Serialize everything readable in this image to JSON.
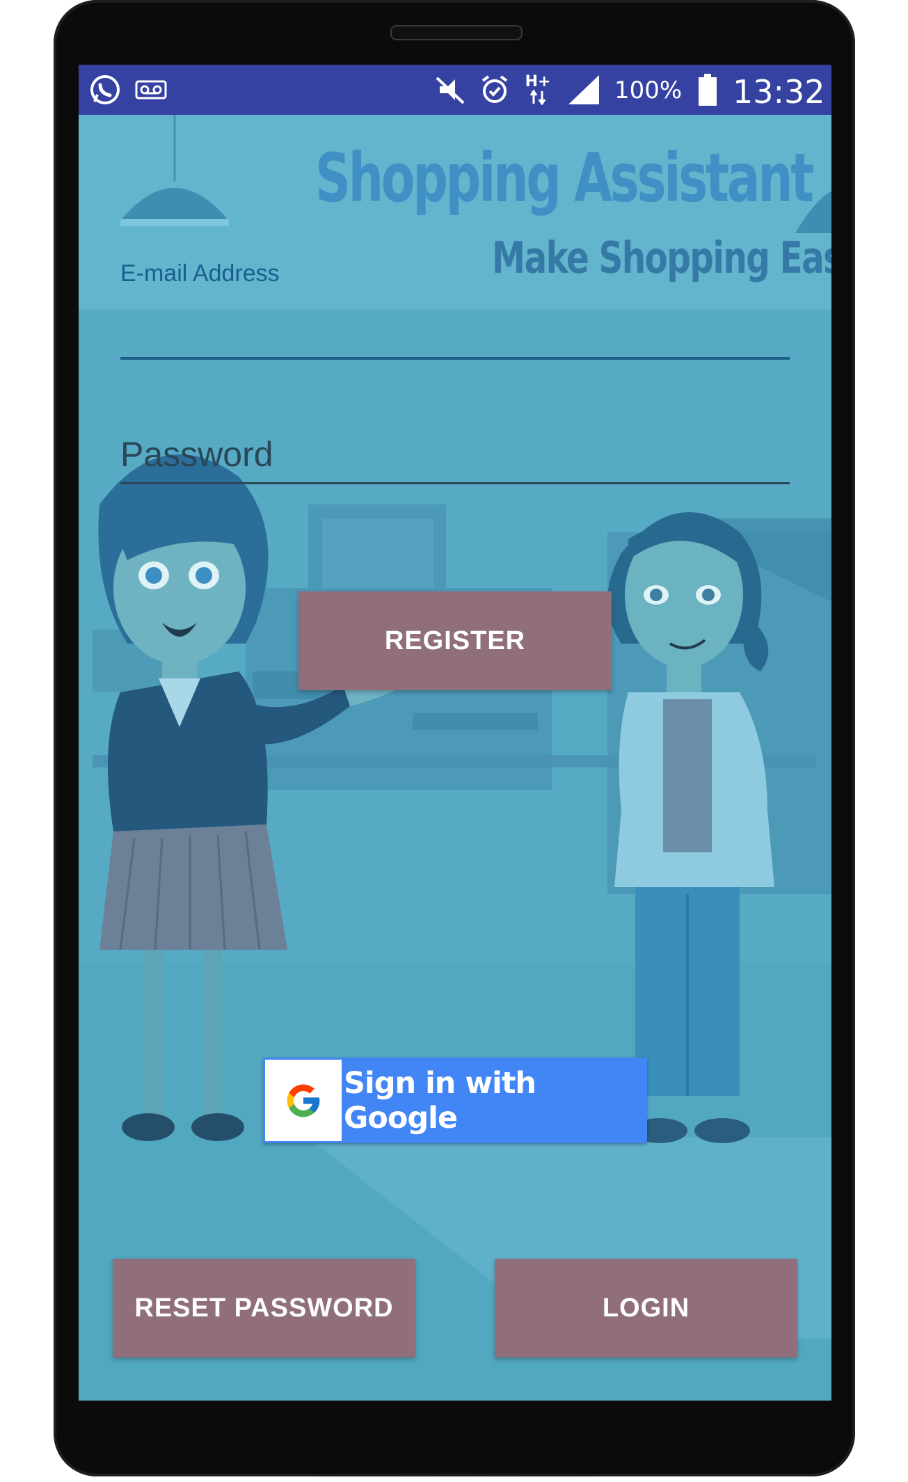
{
  "status_bar": {
    "battery": "100%",
    "time": "13:32",
    "network": "H+",
    "icons": [
      "whatsapp-icon",
      "voicemail-icon",
      "mute-vibrate-icon",
      "alarm-icon",
      "network-hplus-icon",
      "signal-icon",
      "battery-icon"
    ]
  },
  "app": {
    "title": "Shopping Assistant",
    "tagline": "Make Shopping Easy"
  },
  "form": {
    "email_label": "E-mail Address",
    "email_value": "",
    "password_placeholder": "Password",
    "password_value": ""
  },
  "buttons": {
    "register": "REGISTER",
    "google_sign_in": "Sign in with Google",
    "reset_password": "RESET PASSWORD",
    "login": "LOGIN"
  },
  "colors": {
    "status_bar": "#3542a2",
    "screen_background": "#5ab0c9",
    "button": "#916e7b",
    "google_blue": "#4285f4",
    "field_underline": "#1c5d8b"
  }
}
